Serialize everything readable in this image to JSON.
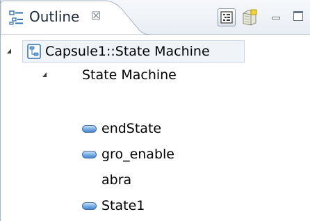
{
  "view": {
    "title": "Outline",
    "close_glyph": "☒",
    "icon": "outline-view-icon",
    "toolbar": {
      "tree_button_icon": "tree-layout-icon",
      "filter_button_icon": "filter-icon",
      "minimize_icon": "minimize-icon",
      "maximize_icon": "maximize-icon"
    }
  },
  "tree": {
    "root": {
      "label": "Capsule1::State Machine",
      "icon": "state-machine-icon",
      "expanded": true
    },
    "state_machine": {
      "label": "State Machine",
      "expanded": true
    },
    "items": [
      {
        "label": "endState",
        "icon": "state-icon"
      },
      {
        "label": "gro_enable",
        "icon": "state-icon"
      },
      {
        "label": "abra",
        "icon": ""
      },
      {
        "label": "State1",
        "icon": "state-icon"
      }
    ]
  },
  "colors": {
    "state_fill": "#7fb2ea",
    "selection_bg": "#f0f4f9",
    "tab_bg": "#ffffff"
  }
}
